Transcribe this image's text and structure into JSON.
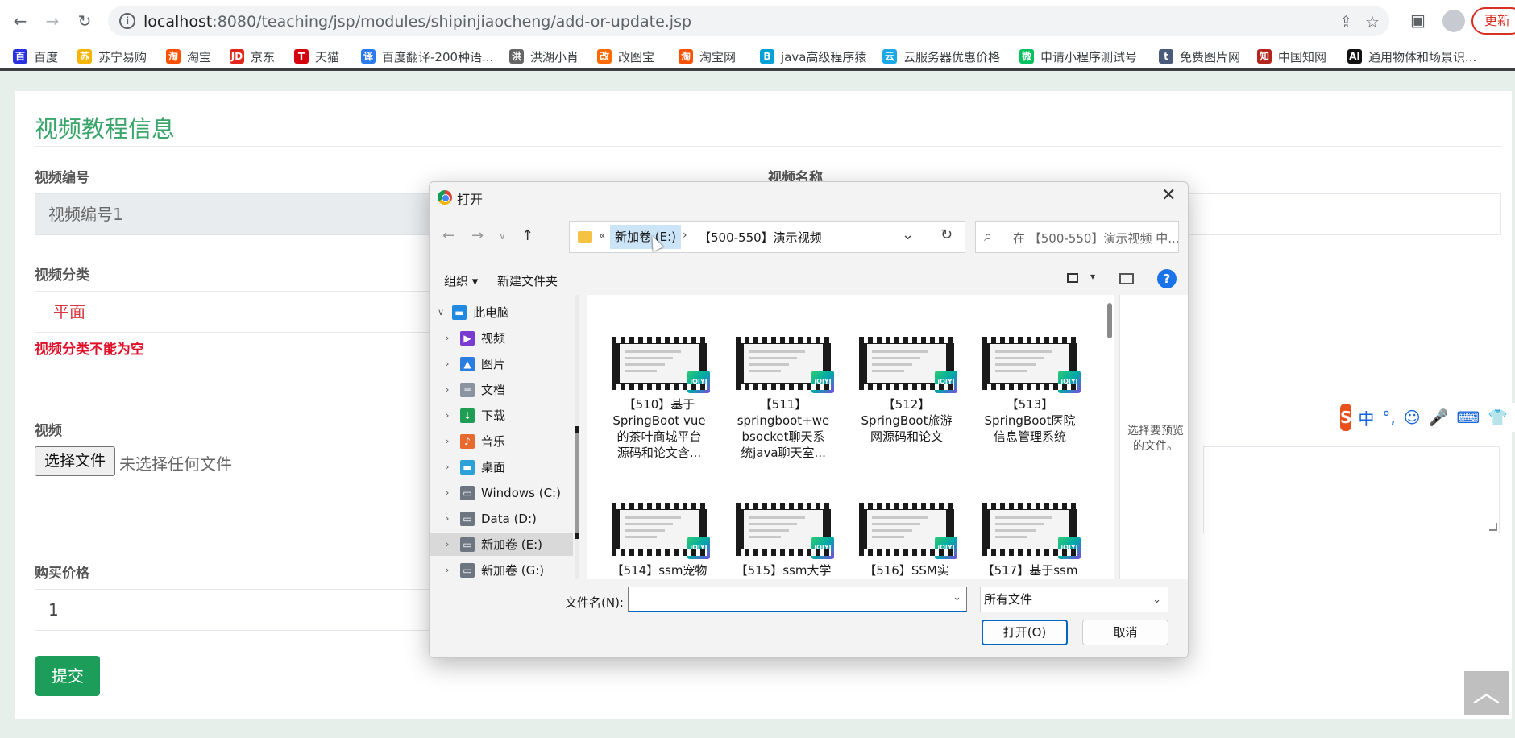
{
  "browser": {
    "url_host": "localhost",
    "url_rest": ":8080/teaching/jsp/modules/shipinjiaocheng/add-or-update.jsp",
    "update_label": "更新"
  },
  "bookmarks": [
    {
      "label": "百度",
      "color": "#2932e1",
      "glyph": "百"
    },
    {
      "label": "苏宁易购",
      "color": "#f6b400",
      "glyph": "苏"
    },
    {
      "label": "淘宝",
      "color": "#ff5000",
      "glyph": "淘"
    },
    {
      "label": "京东",
      "color": "#e1251b",
      "glyph": "JD"
    },
    {
      "label": "天猫",
      "color": "#d6000f",
      "glyph": "T"
    },
    {
      "label": "百度翻译-200种语...",
      "color": "#2b7bf0",
      "glyph": "译"
    },
    {
      "label": "洪湖小肖",
      "color": "#666666",
      "glyph": "洪"
    },
    {
      "label": "改图宝",
      "color": "#ff6a00",
      "glyph": "改"
    },
    {
      "label": "淘宝网",
      "color": "#ff5000",
      "glyph": "淘"
    },
    {
      "label": "java高级程序猿",
      "color": "#00a1d6",
      "glyph": "B"
    },
    {
      "label": "云服务器优惠价格",
      "color": "#1ba8e7",
      "glyph": "云"
    },
    {
      "label": "申请小程序测试号",
      "color": "#07c160",
      "glyph": "微"
    },
    {
      "label": "免费图片网",
      "color": "#4a5a7a",
      "glyph": "t"
    },
    {
      "label": "中国知网",
      "color": "#b3261e",
      "glyph": "知"
    },
    {
      "label": "通用物体和场景识...",
      "color": "#111111",
      "glyph": "AI"
    }
  ],
  "form": {
    "title": "视频教程信息",
    "video_no_label": "视频编号",
    "video_no_value": "视频编号1",
    "video_name_label": "视频名称",
    "category_label": "视频分类",
    "category_value": "平面",
    "category_error": "视频分类不能为空",
    "video_label": "视频",
    "choose_file_label": "选择文件",
    "no_file_text": "未选择任何文件",
    "price_label": "购买价格",
    "price_value": "1",
    "submit_label": "提交"
  },
  "ime": {
    "logo": "S",
    "items": [
      "中",
      "°,",
      "☺",
      "🎤",
      "⌨",
      "👕"
    ]
  },
  "dialog": {
    "title": "打开",
    "path_prefix": "«",
    "path_drive": "新加卷 (E:)",
    "path_sep": "›",
    "path_folder": "【500-550】演示视频",
    "search_placeholder": "在 【500-550】演示视频 中...",
    "organize_label": "组织 ▾",
    "new_folder_label": "新建文件夹",
    "tree": [
      {
        "label": "此电脑",
        "expanded": true,
        "level": 0,
        "icon_color": "#1f8ae0",
        "icon": "▬"
      },
      {
        "label": "视频",
        "level": 1,
        "icon_color": "#7a3bd1",
        "icon": "▶"
      },
      {
        "label": "图片",
        "level": 1,
        "icon_color": "#2a7de1",
        "icon": "▲"
      },
      {
        "label": "文档",
        "level": 1,
        "icon_color": "#8a93a0",
        "icon": "≡"
      },
      {
        "label": "下载",
        "level": 1,
        "icon_color": "#1f9d55",
        "icon": "↓"
      },
      {
        "label": "音乐",
        "level": 1,
        "icon_color": "#e8692e",
        "icon": "♪"
      },
      {
        "label": "桌面",
        "level": 1,
        "icon_color": "#2aa2d8",
        "icon": "▬"
      },
      {
        "label": "Windows (C:)",
        "level": 1,
        "icon_color": "#6d7580",
        "icon": "▭"
      },
      {
        "label": "Data (D:)",
        "level": 1,
        "icon_color": "#6d7580",
        "icon": "▭"
      },
      {
        "label": "新加卷 (E:)",
        "level": 1,
        "icon_color": "#6d7580",
        "icon": "▭",
        "selected": true
      },
      {
        "label": "新加卷 (G:)",
        "level": 1,
        "icon_color": "#6d7580",
        "icon": "▭"
      }
    ],
    "files": [
      {
        "lines": [
          "【510】基于",
          "SpringBoot vue",
          "的茶叶商城平台",
          "源码和论文含..."
        ]
      },
      {
        "lines": [
          "【511】",
          "springboot+we",
          "bsocket聊天系",
          "统java聊天室..."
        ]
      },
      {
        "lines": [
          "【512】",
          "SpringBoot旅游",
          "网源码和论文"
        ]
      },
      {
        "lines": [
          "【513】",
          "SpringBoot医院",
          "信息管理系统"
        ]
      },
      {
        "lines": [
          "【514】ssm宠物"
        ]
      },
      {
        "lines": [
          "【515】ssm大学"
        ]
      },
      {
        "lines": [
          "【516】SSM实"
        ]
      },
      {
        "lines": [
          "【517】基于ssm"
        ]
      }
    ],
    "badge_text": "iQIYI",
    "preview_text": "选择要预览的文件。",
    "filename_label": "文件名(N):",
    "filename_value": "",
    "filetype_value": "所有文件",
    "open_label": "打开(O)",
    "cancel_label": "取消"
  }
}
